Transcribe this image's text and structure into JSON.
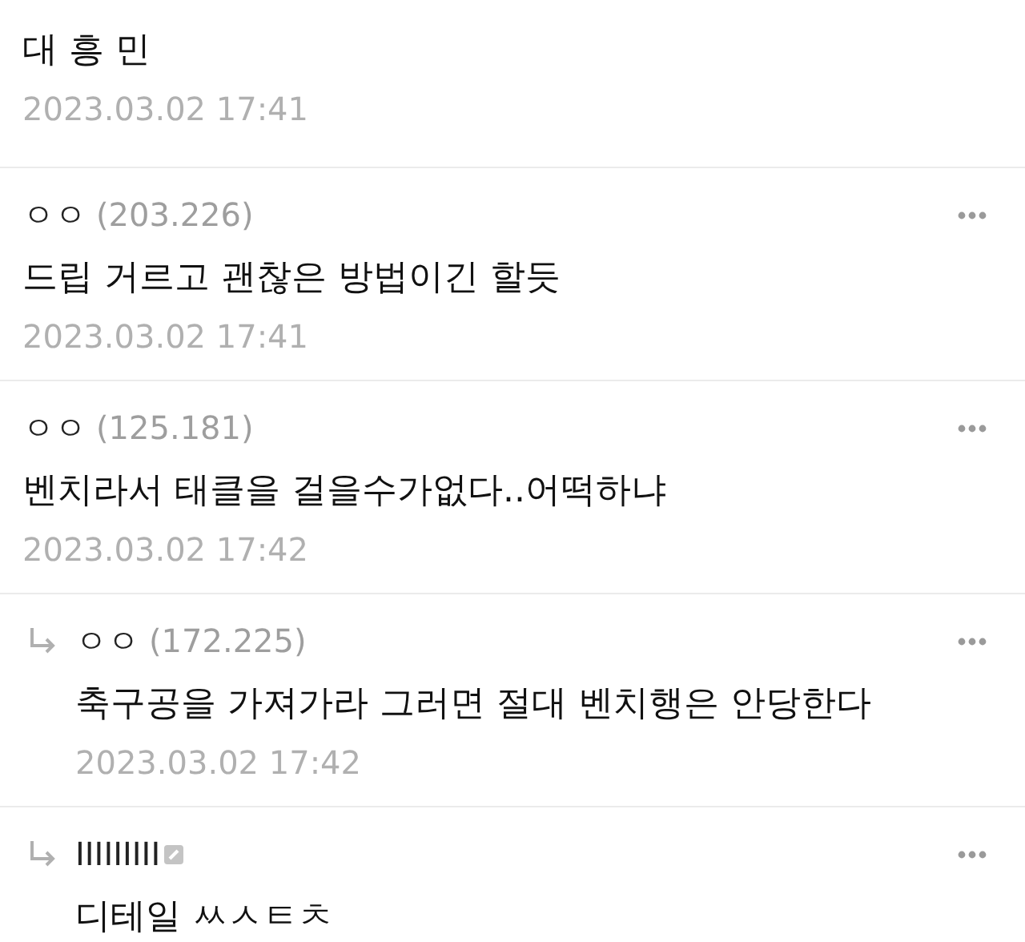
{
  "comments": [
    {
      "kind": "comment",
      "text": "대 흥 민",
      "date": "2023.03.02 17:41",
      "more": false,
      "badge": false
    },
    {
      "kind": "comment",
      "nickname": "ㅇㅇ",
      "ip": "(203.226)",
      "text": "드립 거르고 괜찮은 방법이긴 할듯",
      "date": "2023.03.02 17:41",
      "more": true,
      "badge": false
    },
    {
      "kind": "comment",
      "nickname": "ㅇㅇ",
      "ip": "(125.181)",
      "text": "벤치라서 태클을 걸을수가없다..어떡하냐",
      "date": "2023.03.02 17:42",
      "more": true,
      "badge": false
    },
    {
      "kind": "reply",
      "nickname": "ㅇㅇ",
      "ip": "(172.225)",
      "text": "축구공을 가져가라 그러면 절대 벤치행은 안당한다",
      "date": "2023.03.02 17:42",
      "more": true,
      "badge": false
    },
    {
      "kind": "reply",
      "nickname": "IIIIIIIII",
      "text": "디테일 ㅆㅅㅌㅊ",
      "more": true,
      "badge": true
    }
  ]
}
